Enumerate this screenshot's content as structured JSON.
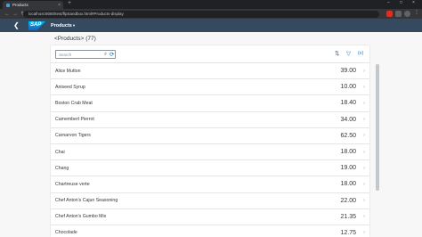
{
  "browser": {
    "tab_title": "Products",
    "tab_close": "×",
    "new_tab": "+",
    "url": "localhost:8080/test/flpSandbox.html#Products-display",
    "window_controls": [
      "–",
      "□",
      "×"
    ]
  },
  "shell": {
    "back": "❮",
    "logo": "SAP",
    "title": "Products",
    "caret": "▾"
  },
  "page": {
    "title": "<Products>",
    "count": "(77)"
  },
  "toolbar": {
    "search_placeholder": "Search",
    "search_icon": "search-icon",
    "refresh_icon": "refresh-icon",
    "sort_icon": "sort-icon",
    "filter_icon": "filter-icon",
    "group_icon": "group-icon"
  },
  "products": [
    {
      "name": "Alice Mutton",
      "price": "39.00"
    },
    {
      "name": "Aniseed Syrup",
      "price": "10.00"
    },
    {
      "name": "Boston Crab Meat",
      "price": "18.40"
    },
    {
      "name": "Camembert Pierrot",
      "price": "34.00"
    },
    {
      "name": "Carnarvon Tigers",
      "price": "62.50"
    },
    {
      "name": "Chai",
      "price": "18.00"
    },
    {
      "name": "Chang",
      "price": "19.00"
    },
    {
      "name": "Chartreuse verte",
      "price": "18.00"
    },
    {
      "name": "Chef Anton's Cajun Seasoning",
      "price": "22.00"
    },
    {
      "name": "Chef Anton's Gumbo Mix",
      "price": "21.35"
    },
    {
      "name": "Chocolade",
      "price": "12.75"
    }
  ],
  "colors": {
    "shell": "#354a5f",
    "accent": "#0a6ed1",
    "browser_dark": "#202124"
  }
}
